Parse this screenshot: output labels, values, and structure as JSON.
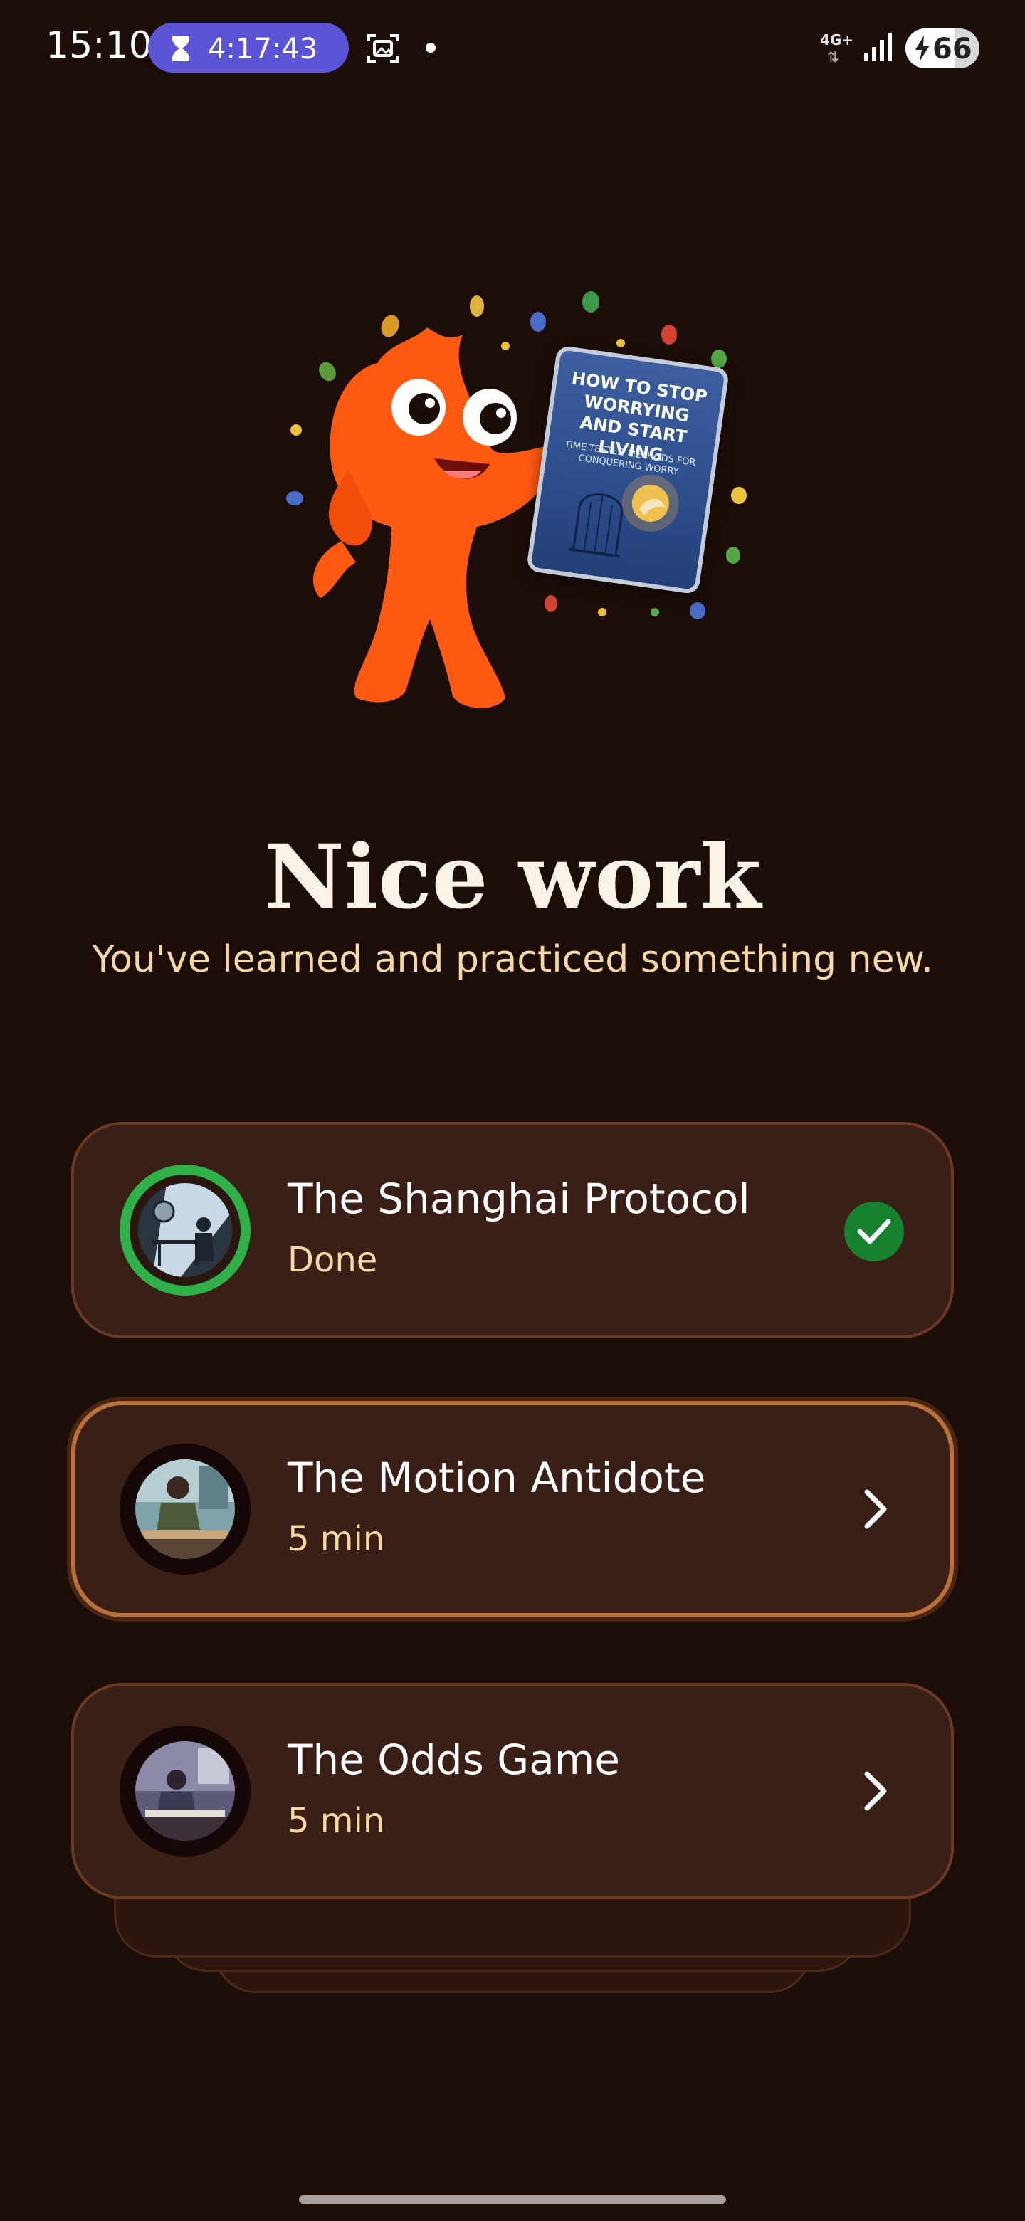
{
  "status_bar": {
    "time": "15:10",
    "timer": "4:17:43",
    "network": "4G+",
    "battery_level": "66",
    "battery_fraction": 0.66
  },
  "illustration": {
    "book_title": "HOW TO STOP WORRYING AND START LIVING",
    "book_subtitle": "TIME-TESTED METHODS FOR CONQUERING WORRY"
  },
  "heading": {
    "title": "Nice work",
    "subtitle": "You've learned and practiced something new."
  },
  "lessons": [
    {
      "title": "The Shanghai Protocol",
      "meta": "Done",
      "status": "done"
    },
    {
      "title": "The Motion Antidote",
      "meta": "5 min",
      "status": "next"
    },
    {
      "title": "The Odds Game",
      "meta": "5 min",
      "status": "locked"
    }
  ],
  "colors": {
    "background": "#1d0d09",
    "card": "#3a1f17",
    "accent_text": "#f6d8a4",
    "done_green": "#2fb049",
    "active_border": "#b9713a"
  }
}
